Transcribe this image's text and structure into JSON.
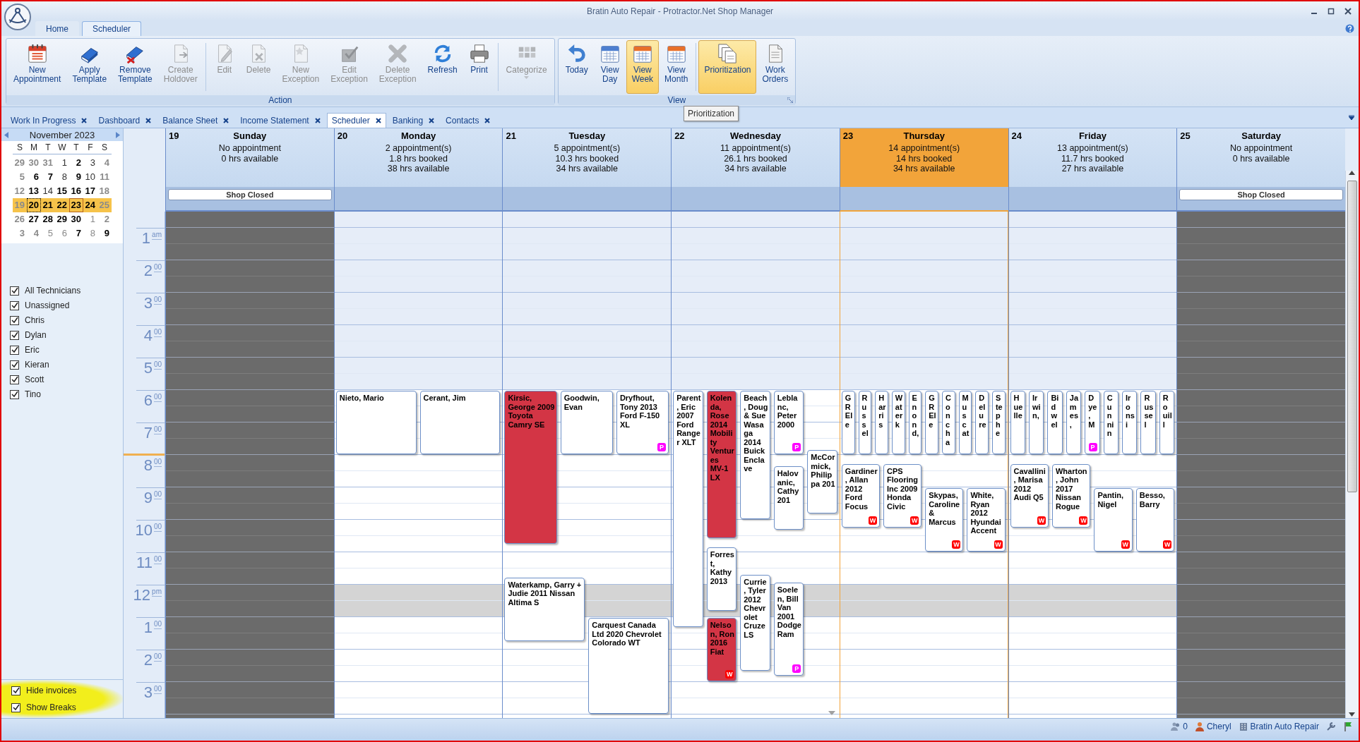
{
  "window": {
    "title": "Bratin Auto Repair - Protractor.Net Shop Manager"
  },
  "ribbon_tabs": [
    {
      "label": "Home",
      "selected": false
    },
    {
      "label": "Scheduler",
      "selected": true
    }
  ],
  "ribbon_groups": [
    {
      "title": "Action",
      "sections": [
        [
          {
            "label": "New Appointment",
            "disabled": false
          },
          {
            "label": "Apply Template",
            "disabled": false
          },
          {
            "label": "Remove Template",
            "disabled": false
          },
          {
            "label": "Create Holdover",
            "disabled": true
          }
        ],
        [
          {
            "label": "Edit",
            "disabled": true
          },
          {
            "label": "Delete",
            "disabled": true
          },
          {
            "label": "New Exception",
            "disabled": true
          },
          {
            "label": "Edit Exception",
            "disabled": true
          },
          {
            "label": "Delete Exception",
            "disabled": true
          },
          {
            "label": "Refresh",
            "disabled": false
          },
          {
            "label": "Print",
            "disabled": false
          }
        ],
        [
          {
            "label": "Categorize",
            "disabled": true,
            "dropdown": true
          }
        ]
      ]
    },
    {
      "title": "View",
      "sections": [
        [
          {
            "label": "Today",
            "selected": false
          },
          {
            "label": "View Day",
            "selected": false
          },
          {
            "label": "View Week",
            "selected": true
          },
          {
            "label": "View Month",
            "selected": false
          }
        ],
        [
          {
            "label": "Prioritization",
            "selected": true
          },
          {
            "label": "Work Orders",
            "selected": false
          }
        ]
      ]
    }
  ],
  "doc_tabs": [
    {
      "label": "Work In Progress",
      "selected": false
    },
    {
      "label": "Dashboard",
      "selected": false
    },
    {
      "label": "Balance Sheet",
      "selected": false
    },
    {
      "label": "Income Statement",
      "selected": false
    },
    {
      "label": "Scheduler",
      "selected": true
    },
    {
      "label": "Banking",
      "selected": false
    },
    {
      "label": "Contacts",
      "selected": false
    }
  ],
  "tooltip": "Prioritization",
  "mini_calendar": {
    "title": "November 2023",
    "weekdays": [
      "S",
      "M",
      "T",
      "W",
      "T",
      "F",
      "S"
    ],
    "weeks": [
      {
        "selected": false,
        "days": [
          {
            "label": "29",
            "bold": true,
            "muted": true,
            "today": false,
            "focused": false
          },
          {
            "label": "30",
            "bold": true,
            "muted": true,
            "today": false,
            "focused": false
          },
          {
            "label": "31",
            "bold": true,
            "muted": true,
            "today": false,
            "focused": false
          },
          {
            "label": "1",
            "bold": false,
            "muted": false,
            "today": false,
            "focused": false
          },
          {
            "label": "2",
            "bold": true,
            "muted": false,
            "today": false,
            "focused": false
          },
          {
            "label": "3",
            "bold": false,
            "muted": false,
            "today": false,
            "focused": false
          },
          {
            "label": "4",
            "bold": true,
            "muted": true,
            "today": false,
            "focused": false
          }
        ]
      },
      {
        "selected": false,
        "days": [
          {
            "label": "5",
            "bold": true,
            "muted": true,
            "today": false,
            "focused": false
          },
          {
            "label": "6",
            "bold": true,
            "muted": false,
            "today": false,
            "focused": false
          },
          {
            "label": "7",
            "bold": true,
            "muted": false,
            "today": false,
            "focused": false
          },
          {
            "label": "8",
            "bold": false,
            "muted": false,
            "today": false,
            "focused": false
          },
          {
            "label": "9",
            "bold": true,
            "muted": false,
            "today": false,
            "focused": false
          },
          {
            "label": "10",
            "bold": false,
            "muted": false,
            "today": false,
            "focused": false
          },
          {
            "label": "11",
            "bold": true,
            "muted": true,
            "today": false,
            "focused": false
          }
        ]
      },
      {
        "selected": false,
        "days": [
          {
            "label": "12",
            "bold": true,
            "muted": true,
            "today": false,
            "focused": false
          },
          {
            "label": "13",
            "bold": true,
            "muted": false,
            "today": false,
            "focused": false
          },
          {
            "label": "14",
            "bold": false,
            "muted": false,
            "today": false,
            "focused": false
          },
          {
            "label": "15",
            "bold": true,
            "muted": false,
            "today": false,
            "focused": false
          },
          {
            "label": "16",
            "bold": true,
            "muted": false,
            "today": false,
            "focused": false
          },
          {
            "label": "17",
            "bold": true,
            "muted": false,
            "today": false,
            "focused": false
          },
          {
            "label": "18",
            "bold": true,
            "muted": true,
            "today": false,
            "focused": false
          }
        ]
      },
      {
        "selected": true,
        "days": [
          {
            "label": "19",
            "bold": true,
            "muted": true,
            "today": false,
            "focused": false
          },
          {
            "label": "20",
            "bold": true,
            "muted": false,
            "today": false,
            "focused": true
          },
          {
            "label": "21",
            "bold": true,
            "muted": false,
            "today": false,
            "focused": false
          },
          {
            "label": "22",
            "bold": true,
            "muted": false,
            "today": false,
            "focused": false
          },
          {
            "label": "23",
            "bold": true,
            "muted": false,
            "today": true,
            "focused": false
          },
          {
            "label": "24",
            "bold": true,
            "muted": false,
            "today": false,
            "focused": false
          },
          {
            "label": "25",
            "bold": true,
            "muted": true,
            "today": false,
            "focused": false
          }
        ]
      },
      {
        "selected": false,
        "days": [
          {
            "label": "26",
            "bold": true,
            "muted": true,
            "today": false,
            "focused": false
          },
          {
            "label": "27",
            "bold": true,
            "muted": false,
            "today": false,
            "focused": false
          },
          {
            "label": "28",
            "bold": true,
            "muted": false,
            "today": false,
            "focused": false
          },
          {
            "label": "29",
            "bold": true,
            "muted": false,
            "today": false,
            "focused": false
          },
          {
            "label": "30",
            "bold": true,
            "muted": false,
            "today": false,
            "focused": false
          },
          {
            "label": "1",
            "bold": false,
            "muted": true,
            "today": false,
            "focused": false
          },
          {
            "label": "2",
            "bold": true,
            "muted": true,
            "today": false,
            "focused": false
          }
        ]
      },
      {
        "selected": false,
        "days": [
          {
            "label": "3",
            "bold": true,
            "muted": true,
            "today": false,
            "focused": false
          },
          {
            "label": "4",
            "bold": true,
            "muted": true,
            "today": false,
            "focused": false
          },
          {
            "label": "5",
            "bold": false,
            "muted": true,
            "today": false,
            "focused": false
          },
          {
            "label": "6",
            "bold": false,
            "muted": true,
            "today": false,
            "focused": false
          },
          {
            "label": "7",
            "bold": true,
            "muted": false,
            "today": false,
            "focused": false
          },
          {
            "label": "8",
            "bold": false,
            "muted": true,
            "today": false,
            "focused": false
          },
          {
            "label": "9",
            "bold": true,
            "muted": false,
            "today": false,
            "focused": false
          }
        ]
      }
    ]
  },
  "technicians": [
    {
      "label": "All Technicians",
      "checked": true
    },
    {
      "label": "Unassigned",
      "checked": true
    },
    {
      "label": "Chris",
      "checked": true
    },
    {
      "label": "Dylan",
      "checked": true
    },
    {
      "label": "Eric",
      "checked": true
    },
    {
      "label": "Kieran",
      "checked": true
    },
    {
      "label": "Scott",
      "checked": true
    },
    {
      "label": "Tino",
      "checked": true
    }
  ],
  "options": [
    {
      "label": "Hide invoices",
      "checked": true
    },
    {
      "label": "Show Breaks",
      "checked": true
    }
  ],
  "schedule": {
    "ruler": [
      {
        "hour": "1",
        "suffix": "am"
      },
      {
        "hour": "2",
        "suffix": "00"
      },
      {
        "hour": "3",
        "suffix": "00"
      },
      {
        "hour": "4",
        "suffix": "00"
      },
      {
        "hour": "5",
        "suffix": "00"
      },
      {
        "hour": "6",
        "suffix": "00"
      },
      {
        "hour": "7",
        "suffix": "00"
      },
      {
        "hour": "8",
        "suffix": "00"
      },
      {
        "hour": "9",
        "suffix": "00"
      },
      {
        "hour": "10",
        "suffix": "00"
      },
      {
        "hour": "11",
        "suffix": "00"
      },
      {
        "hour": "12",
        "suffix": "pm"
      },
      {
        "hour": "1",
        "suffix": "00"
      },
      {
        "hour": "2",
        "suffix": "00"
      },
      {
        "hour": "3",
        "suffix": "00"
      }
    ],
    "days": [
      {
        "number": "19",
        "name": "Sunday",
        "closed": true,
        "selected": false,
        "more_below": false,
        "summary": [
          "No appointment",
          "0 hrs available"
        ],
        "banner": "Shop Closed"
      },
      {
        "number": "20",
        "name": "Monday",
        "closed": false,
        "selected": false,
        "more_below": false,
        "summary": [
          "2 appointment(s)",
          "1.8 hrs booked",
          "38 hrs available"
        ],
        "appointments": [
          {
            "text": "Nieto, Mario",
            "color": "#ffffff"
          },
          {
            "text": "Cerant, Jim",
            "color": "#ffffff"
          }
        ]
      },
      {
        "number": "21",
        "name": "Tuesday",
        "closed": false,
        "selected": false,
        "more_below": false,
        "summary": [
          "5 appointment(s)",
          "10.3 hrs booked",
          "34 hrs available"
        ],
        "appointments": [
          {
            "text": "Kirsic, George 2009 Toyota Camry SE",
            "color": "#d33545"
          },
          {
            "text": "Goodwin, Evan",
            "color": "#ffffff"
          },
          {
            "text": "Dryfhout, Tony 2013 Ford F-150 XL",
            "color": "#ffffff",
            "badge": {
              "text": "P",
              "color": "#ff00ff"
            }
          },
          {
            "text": "Waterkamp, Garry + Judie 2011 Nissan Altima S",
            "color": "#ffffff"
          },
          {
            "text": "Carquest Canada Ltd 2020 Chevrolet Colorado WT",
            "color": "#ffffff"
          }
        ]
      },
      {
        "number": "22",
        "name": "Wednesday",
        "closed": false,
        "selected": false,
        "more_below": true,
        "summary": [
          "11 appointment(s)",
          "26.1 hrs booked",
          "34 hrs available"
        ],
        "appointments": [
          {
            "text": "Parent, Eric 2007 Ford Ranger XLT",
            "color": "#ffffff"
          },
          {
            "text": "Kolenda, Rose 2014 Mobility Ventures MV-1 LX",
            "color": "#d33545"
          },
          {
            "text": "Forrest, Kathy 2013",
            "color": "#ffffff"
          },
          {
            "text": "Nelson, Ron 2016 Fiat",
            "color": "#d33545",
            "badge": {
              "text": "W",
              "color": "#ff0000"
            }
          },
          {
            "text": "Beach, Doug & Sue Wasaga 2014 Buick Enclave",
            "color": "#ffffff"
          },
          {
            "text": "Currie, Tyler 2012 Chevrolet Cruze LS",
            "color": "#ffffff"
          },
          {
            "text": "Leblanc, Peter 2000",
            "color": "#ffffff",
            "badge": {
              "text": "P",
              "color": "#ff00ff"
            }
          },
          {
            "text": "Halovanic, Cathy 201",
            "color": "#ffffff"
          },
          {
            "text": "Soelen, Bill Van 2001 Dodge Ram",
            "color": "#ffffff",
            "badge": {
              "text": "P",
              "color": "#ff00ff"
            }
          },
          {
            "text": "McCormick, Philippa 201",
            "color": "#ffffff"
          }
        ]
      },
      {
        "number": "23",
        "name": "Thursday",
        "closed": false,
        "selected": true,
        "more_below": false,
        "summary": [
          "14 appointment(s)",
          "14 hrs booked",
          "34 hrs available"
        ],
        "appointments": [
          {
            "text": "GR Ele",
            "color": "#ffffff"
          },
          {
            "text": "Russel",
            "color": "#ffffff"
          },
          {
            "text": "Harris",
            "color": "#ffffff"
          },
          {
            "text": "Waterk",
            "color": "#ffffff"
          },
          {
            "text": "Enond,",
            "color": "#ffffff"
          },
          {
            "text": "GR Ele",
            "color": "#ffffff"
          },
          {
            "text": "Concha",
            "color": "#ffffff"
          },
          {
            "text": "Muscat",
            "color": "#ffffff"
          },
          {
            "text": "Delure",
            "color": "#ffffff"
          },
          {
            "text": "Stephe",
            "color": "#ffffff"
          },
          {
            "text": "Gardiner, Allan 2012 Ford Focus",
            "color": "#ffffff",
            "badge": {
              "text": "W",
              "color": "#ff0000"
            }
          },
          {
            "text": "CPS Flooring Inc 2009 Honda Civic",
            "color": "#ffffff",
            "badge": {
              "text": "W",
              "color": "#ff0000"
            }
          },
          {
            "text": "Skypas, Caroline & Marcus",
            "color": "#ffffff",
            "badge": {
              "text": "W",
              "color": "#ff0000"
            }
          },
          {
            "text": "White, Ryan 2012 Hyundai Accent",
            "color": "#ffffff",
            "badge": {
              "text": "W",
              "color": "#ff0000"
            }
          }
        ]
      },
      {
        "number": "24",
        "name": "Friday",
        "closed": false,
        "selected": false,
        "more_below": false,
        "summary": [
          "13 appointment(s)",
          "11.7 hrs booked",
          "27 hrs available"
        ],
        "appointments": [
          {
            "text": "Huelle",
            "color": "#ffffff"
          },
          {
            "text": "Irwin,",
            "color": "#ffffff"
          },
          {
            "text": "Bidwel",
            "color": "#ffffff"
          },
          {
            "text": "James,",
            "color": "#ffffff"
          },
          {
            "text": "Dye, M",
            "color": "#ffffff",
            "badge": {
              "text": "P",
              "color": "#ff00ff"
            }
          },
          {
            "text": "Cunnin",
            "color": "#ffffff"
          },
          {
            "text": "Ironsi",
            "color": "#ffffff"
          },
          {
            "text": "Russel",
            "color": "#ffffff"
          },
          {
            "text": "Rouill",
            "color": "#ffffff"
          },
          {
            "text": "Cavallini, Marisa 2012 Audi Q5",
            "color": "#ffffff",
            "badge": {
              "text": "W",
              "color": "#ff0000"
            }
          },
          {
            "text": "Wharton, John 2017 Nissan Rogue",
            "color": "#ffffff",
            "badge": {
              "text": "W",
              "color": "#ff0000"
            }
          },
          {
            "text": "Pantin, Nigel",
            "color": "#ffffff",
            "badge": {
              "text": "W",
              "color": "#ff0000"
            }
          },
          {
            "text": "Besso, Barry",
            "color": "#ffffff",
            "badge": {
              "text": "W",
              "color": "#ff0000"
            }
          }
        ]
      },
      {
        "number": "25",
        "name": "Saturday",
        "closed": true,
        "selected": false,
        "more_below": false,
        "summary": [
          "No appointment",
          "0 hrs available"
        ],
        "banner": "Shop Closed"
      }
    ]
  },
  "status_bar": [
    {
      "text": "0"
    },
    {
      "text": "Cheryl"
    },
    {
      "text": "Bratin Auto Repair"
    }
  ]
}
